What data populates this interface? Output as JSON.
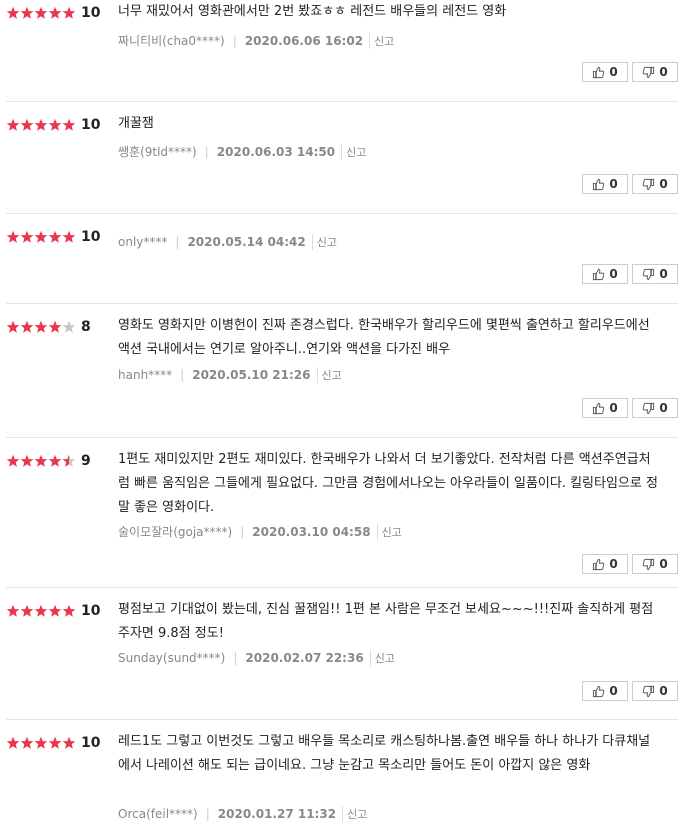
{
  "colors": {
    "star_on": "#e8364b",
    "star_off": "#c8c8c8"
  },
  "reviews": [
    {
      "stars": 5,
      "score": "10",
      "text": "너무 재밌어서 영화관에서만 2번 봤죠ㅎㅎ 레전드 배우들의 레전드 영화",
      "author": "짜니티비(cha0****)",
      "date": "2020.06.06 16:02",
      "report": "신고",
      "up": "0",
      "down": "0"
    },
    {
      "stars": 5,
      "score": "10",
      "text": "개꿀잼",
      "author": "쌩훈(9tld****)",
      "date": "2020.06.03 14:50",
      "report": "신고",
      "up": "0",
      "down": "0"
    },
    {
      "stars": 5,
      "score": "10",
      "text": "",
      "author": "only****",
      "date": "2020.05.14 04:42",
      "report": "신고",
      "up": "0",
      "down": "0"
    },
    {
      "stars": 4,
      "score": "8",
      "text": "영화도 영화지만 이병헌이 진짜 존경스럽다. 한국배우가 할리우드에 몇편씩 출연하고 할리우드에선 액션 국내에서는 연기로 알아주니..연기와 액션을 다가진 배우",
      "author": "hanh****",
      "date": "2020.05.10 21:26",
      "report": "신고",
      "up": "0",
      "down": "0"
    },
    {
      "stars": 4.5,
      "score": "9",
      "text": "1편도 재미있지만 2편도 재미있다. 한국배우가 나와서 더 보기좋았다. 전작처럼 다른 액션주연급처럼 빠른 움직임은 그들에게 필요없다. 그만큼 경험에서나오는 아우라들이 일품이다. 킬링타임으로 정말 좋은 영화이다.",
      "author": "술이모잘라(goja****)",
      "date": "2020.03.10 04:58",
      "report": "신고",
      "up": "0",
      "down": "0"
    },
    {
      "stars": 5,
      "score": "10",
      "text": "평점보고 기대없이 봤는데, 진심 꿀잼임!! 1편 본 사람은 무조건 보세요~~~!!!진짜 솔직하게 평점 주자면 9.8점 정도!",
      "author": "Sunday(sund****)",
      "date": "2020.02.07 22:36",
      "report": "신고",
      "up": "0",
      "down": "0"
    },
    {
      "stars": 5,
      "score": "10",
      "text": "레드1도 그렇고 이번것도 그렇고 배우들 목소리로 캐스팅하나봄.출연 배우들 하나 하나가 다큐채널에서 나레이션 해도 되는 급이네요. 그냥 눈감고 목소리만 들어도 돈이 아깝지 않은 영화",
      "author": "Orca(feil****)",
      "date": "2020.01.27 11:32",
      "report": "신고",
      "up": "",
      "down": ""
    }
  ]
}
